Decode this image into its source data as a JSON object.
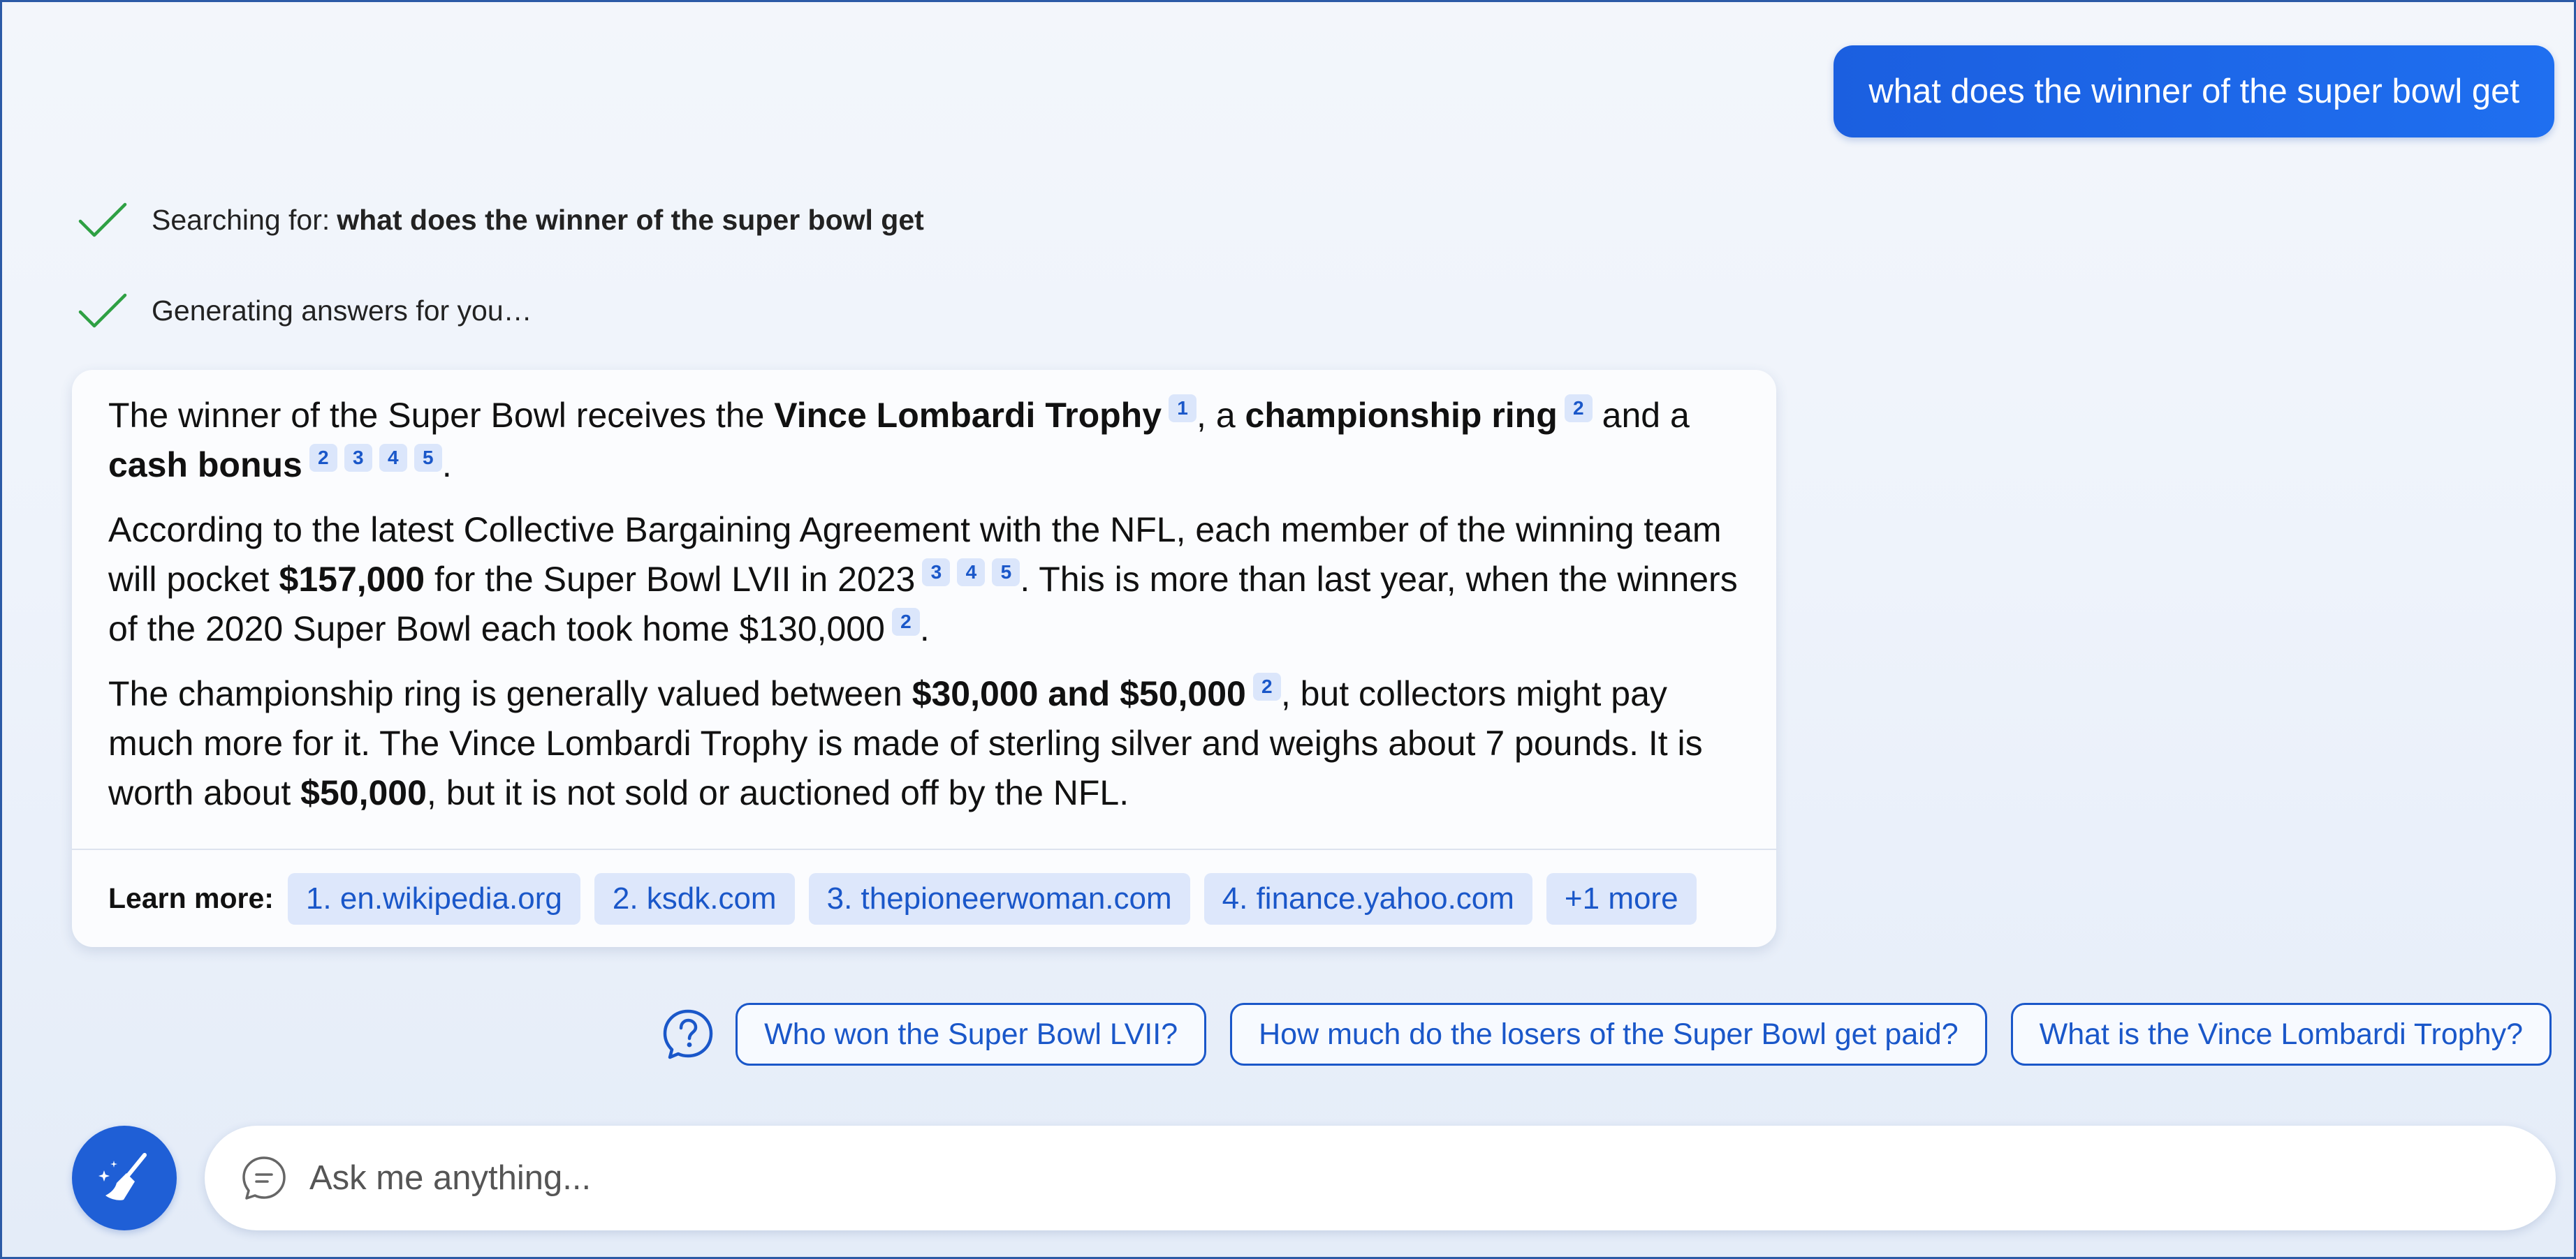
{
  "user_query": "what does the winner of the super bowl get",
  "status": {
    "searching_label": "Searching for:",
    "searching_query": "what does the winner of the super bowl get",
    "generating_label": "Generating answers for you…"
  },
  "answer": {
    "p1": {
      "t1": "The winner of the Super Bowl receives the ",
      "b1": "Vince Lombardi Trophy",
      "c1": "1",
      "t2": ", a ",
      "b2": "championship ring",
      "c2": "2",
      "t3": " and a ",
      "b3": "cash bonus",
      "c3": [
        "2",
        "3",
        "4",
        "5"
      ],
      "t4": "."
    },
    "p2": {
      "t1": "According to the latest Collective Bargaining Agreement with the NFL, each member of the winning team will pocket ",
      "b1": "$157,000",
      "t2": " for the Super Bowl LVII in 2023",
      "c1": [
        "3",
        "4",
        "5"
      ],
      "t3": ". This is more than last year, when the winners of the 2020 Super Bowl each took home $130,000",
      "c2": "2",
      "t4": "."
    },
    "p3": {
      "t1": "The championship ring is generally valued between ",
      "b1": "$30,000 and $50,000",
      "c1": "2",
      "t2": ", but collectors might pay much more for it. The Vince Lombardi Trophy is made of sterling silver and weighs about 7 pounds. It is worth about ",
      "b2": "$50,000",
      "t3": ", but it is not sold or auctioned off by the NFL."
    }
  },
  "learn_more": {
    "label": "Learn more:",
    "sources": [
      "1. en.wikipedia.org",
      "2. ksdk.com",
      "3. thepioneerwoman.com",
      "4. finance.yahoo.com"
    ],
    "more": "+1 more"
  },
  "suggestions": [
    "Who won the Super Bowl LVII?",
    "How much do the losers of the Super Bowl get paid?",
    "What is the Vince Lombardi Trophy?"
  ],
  "input": {
    "placeholder": "Ask me anything..."
  },
  "icons": {
    "status": "checkmark-icon",
    "help": "question-circle-icon",
    "new_topic": "broom-icon",
    "chat": "chat-bubble-icon"
  },
  "colors": {
    "accent": "#1a57c9",
    "user_bubble": "#1b5fe0",
    "check": "#2ea043",
    "cite_bg": "#dbe6fb"
  }
}
